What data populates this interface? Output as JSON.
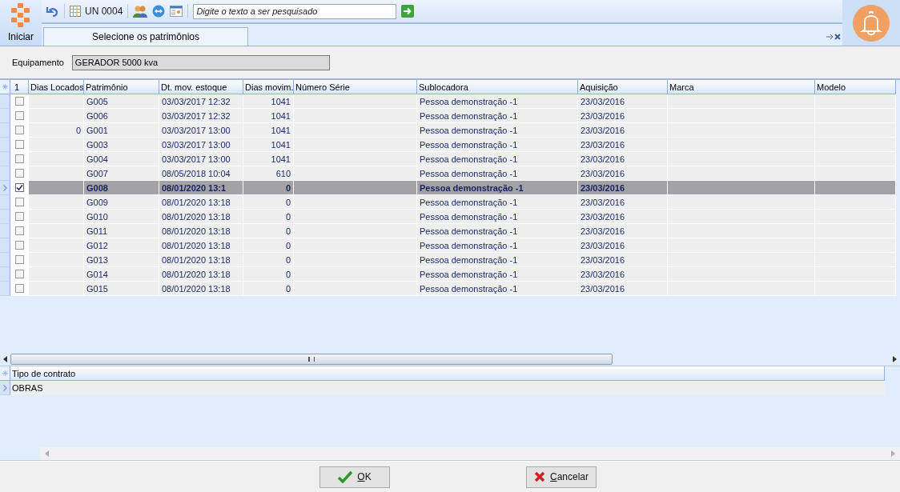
{
  "toolbar": {
    "start_label": "Iniciar",
    "unit": "UN 0004",
    "search": {
      "placeholder": "Digite o texto a ser pesquisado"
    }
  },
  "tabs": [
    {
      "label": "Selecione os patrimônios",
      "selected": true
    }
  ],
  "equipment": {
    "label": "Equipamento",
    "value": "GERADOR 5000 kva"
  },
  "table": {
    "check_header": "1",
    "columns": [
      "Dias Locados",
      "Patrimônio",
      "Dt. mov. estoque",
      "Dias movim.",
      "Número Série",
      "Sublocadora",
      "Aquisição",
      "Marca",
      "Modelo"
    ],
    "rows": [
      {
        "checked": false,
        "selected": false,
        "patrimonio": "G005",
        "dt_mov": "03/03/2017 12:32",
        "dias_movim": "1041",
        "sublocadora": "Pessoa demonstração -1",
        "aquisicao": "23/03/2016"
      },
      {
        "checked": false,
        "selected": false,
        "patrimonio": "G006",
        "dt_mov": "03/03/2017 12:32",
        "dias_movim": "1041",
        "sublocadora": "Pessoa demonstração -1",
        "aquisicao": "23/03/2016"
      },
      {
        "checked": false,
        "selected": false,
        "dias_locados": "0",
        "patrimonio": "G001",
        "dt_mov": "03/03/2017 13:00",
        "dias_movim": "1041",
        "sublocadora": "Pessoa demonstração -1",
        "aquisicao": "23/03/2016"
      },
      {
        "checked": false,
        "selected": false,
        "patrimonio": "G003",
        "dt_mov": "03/03/2017 13:00",
        "dias_movim": "1041",
        "sublocadora": "Pessoa demonstração -1",
        "aquisicao": "23/03/2016"
      },
      {
        "checked": false,
        "selected": false,
        "patrimonio": "G004",
        "dt_mov": "03/03/2017 13:00",
        "dias_movim": "1041",
        "sublocadora": "Pessoa demonstração -1",
        "aquisicao": "23/03/2016"
      },
      {
        "checked": false,
        "selected": false,
        "patrimonio": "G007",
        "dt_mov": "08/05/2018 10:04",
        "dias_movim": "610",
        "sublocadora": "Pessoa demonstração -1",
        "aquisicao": "23/03/2016"
      },
      {
        "checked": true,
        "selected": true,
        "patrimonio": "G008",
        "dt_mov": "08/01/2020 13:1",
        "dias_movim": "0",
        "sublocadora": "Pessoa demonstração -1",
        "aquisicao": "23/03/2016"
      },
      {
        "checked": false,
        "selected": false,
        "patrimonio": "G009",
        "dt_mov": "08/01/2020 13:18",
        "dias_movim": "0",
        "sublocadora": "Pessoa demonstração -1",
        "aquisicao": "23/03/2016"
      },
      {
        "checked": false,
        "selected": false,
        "patrimonio": "G010",
        "dt_mov": "08/01/2020 13:18",
        "dias_movim": "0",
        "sublocadora": "Pessoa demonstração -1",
        "aquisicao": "23/03/2016"
      },
      {
        "checked": false,
        "selected": false,
        "patrimonio": "G011",
        "dt_mov": "08/01/2020 13:18",
        "dias_movim": "0",
        "sublocadora": "Pessoa demonstração -1",
        "aquisicao": "23/03/2016"
      },
      {
        "checked": false,
        "selected": false,
        "patrimonio": "G012",
        "dt_mov": "08/01/2020 13:18",
        "dias_movim": "0",
        "sublocadora": "Pessoa demonstração -1",
        "aquisicao": "23/03/2016"
      },
      {
        "checked": false,
        "selected": false,
        "patrimonio": "G013",
        "dt_mov": "08/01/2020 13:18",
        "dias_movim": "0",
        "sublocadora": "Pessoa demonstração -1",
        "aquisicao": "23/03/2016"
      },
      {
        "checked": false,
        "selected": false,
        "patrimonio": "G014",
        "dt_mov": "08/01/2020 13:18",
        "dias_movim": "0",
        "sublocadora": "Pessoa demonstração -1",
        "aquisicao": "23/03/2016"
      },
      {
        "checked": false,
        "selected": false,
        "patrimonio": "G015",
        "dt_mov": "08/01/2020 13:18",
        "dias_movim": "0",
        "sublocadora": "Pessoa demonstração -1",
        "aquisicao": "23/03/2016"
      }
    ]
  },
  "contracts": {
    "columns": [
      "Tipo de contrato"
    ],
    "rows": [
      {
        "tipo": "OBRAS",
        "selected": true
      }
    ]
  },
  "buttons": [
    {
      "label": "OK",
      "kind": "ok"
    },
    {
      "label": "Cancelar",
      "kind": "cancel"
    }
  ]
}
